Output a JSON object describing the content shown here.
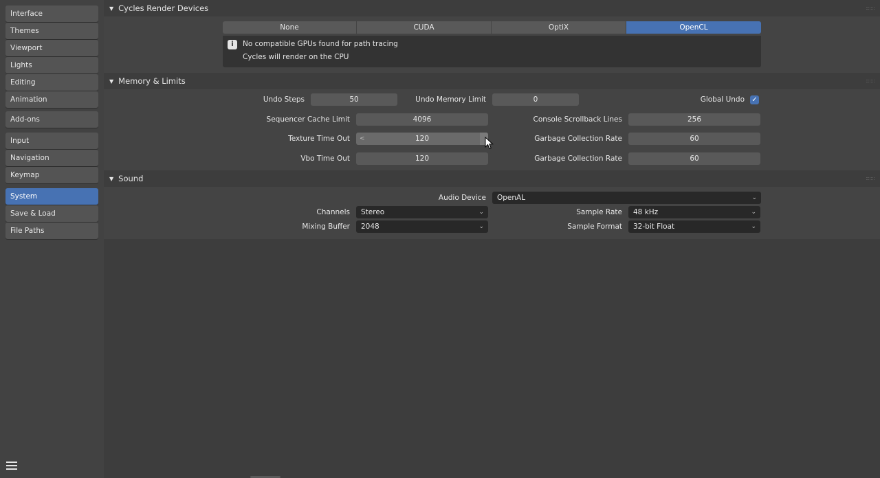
{
  "sidebar": {
    "group1": [
      "Interface",
      "Themes",
      "Viewport",
      "Lights",
      "Editing",
      "Animation"
    ],
    "group2": [
      "Add-ons"
    ],
    "group3": [
      "Input",
      "Navigation",
      "Keymap"
    ],
    "group4": [
      "System",
      "Save & Load",
      "File Paths"
    ],
    "active": "System"
  },
  "cycles": {
    "title": "Cycles Render Devices",
    "options": [
      "None",
      "CUDA",
      "OptiX",
      "OpenCL"
    ],
    "selected": "OpenCL",
    "info_line1": "No compatible GPUs found for path tracing",
    "info_line2": "Cycles will render on the CPU"
  },
  "memory": {
    "title": "Memory & Limits",
    "undo_steps_label": "Undo Steps",
    "undo_steps": "50",
    "undo_memory_label": "Undo Memory Limit",
    "undo_memory": "0",
    "global_undo_label": "Global Undo",
    "global_undo": true,
    "seq_cache_label": "Sequencer Cache Limit",
    "seq_cache": "4096",
    "console_lines_label": "Console Scrollback Lines",
    "console_lines": "256",
    "texture_timeout_label": "Texture Time Out",
    "texture_timeout": "120",
    "gc_rate_label_1": "Garbage Collection Rate",
    "gc_rate_1": "60",
    "vbo_timeout_label": "Vbo Time Out",
    "vbo_timeout": "120",
    "gc_rate_label_2": "Garbage Collection Rate",
    "gc_rate_2": "60"
  },
  "sound": {
    "title": "Sound",
    "audio_device_label": "Audio Device",
    "audio_device": "OpenAL",
    "channels_label": "Channels",
    "channels": "Stereo",
    "sample_rate_label": "Sample Rate",
    "sample_rate": "48 kHz",
    "mixing_buffer_label": "Mixing Buffer",
    "mixing_buffer": "2048",
    "sample_format_label": "Sample Format",
    "sample_format": "32-bit Float"
  },
  "colors": {
    "accent": "#4772b3",
    "background": "#3d3d3d",
    "panel": "#444444",
    "sidebar_button": "#545454"
  },
  "icons": {
    "menu": "hamburger-icon",
    "info": "info-icon",
    "collapse": "triangle-down-icon",
    "check": "checkmark-icon",
    "dropdown": "chevron-down-icon"
  }
}
